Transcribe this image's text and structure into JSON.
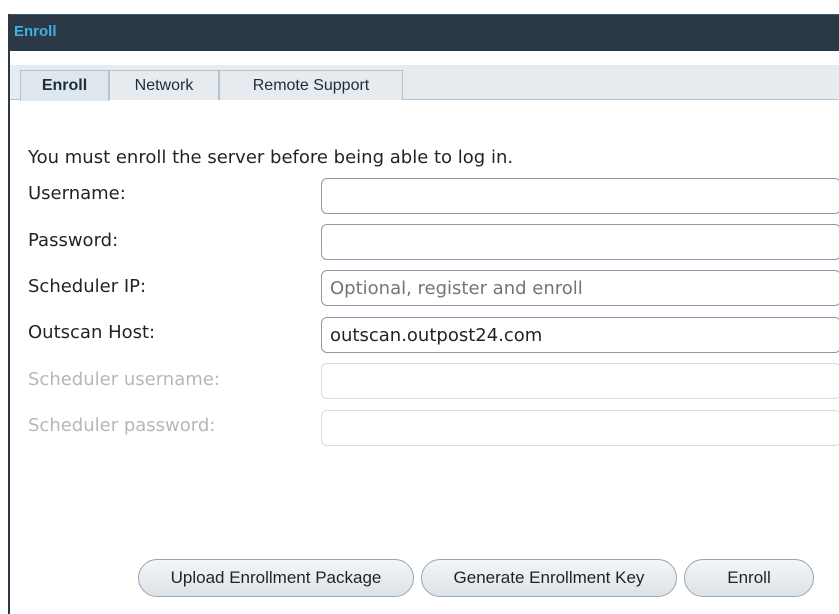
{
  "window": {
    "title": "Enroll"
  },
  "tabs": [
    {
      "label": "Enroll",
      "active": true
    },
    {
      "label": "Network",
      "active": false
    },
    {
      "label": "Remote Support",
      "active": false
    }
  ],
  "form": {
    "intro": "You must enroll the server before being able to log in.",
    "fields": [
      {
        "label": "Username:",
        "value": "",
        "placeholder": "",
        "disabled": false
      },
      {
        "label": "Password:",
        "value": "",
        "placeholder": "",
        "disabled": false
      },
      {
        "label": "Scheduler IP:",
        "value": "",
        "placeholder": "Optional, register and enroll",
        "disabled": false
      },
      {
        "label": "Outscan Host:",
        "value": "outscan.outpost24.com",
        "placeholder": "",
        "disabled": false
      },
      {
        "label": "Scheduler username:",
        "value": "",
        "placeholder": "",
        "disabled": true
      },
      {
        "label": "Scheduler password:",
        "value": "",
        "placeholder": "",
        "disabled": true
      }
    ]
  },
  "buttons": {
    "upload": "Upload Enrollment Package",
    "generate": "Generate Enrollment Key",
    "enroll": "Enroll"
  },
  "colors": {
    "titlebar": "#2b3845",
    "title_text": "#3fb1e8",
    "tabbar": "#e6ebef"
  }
}
